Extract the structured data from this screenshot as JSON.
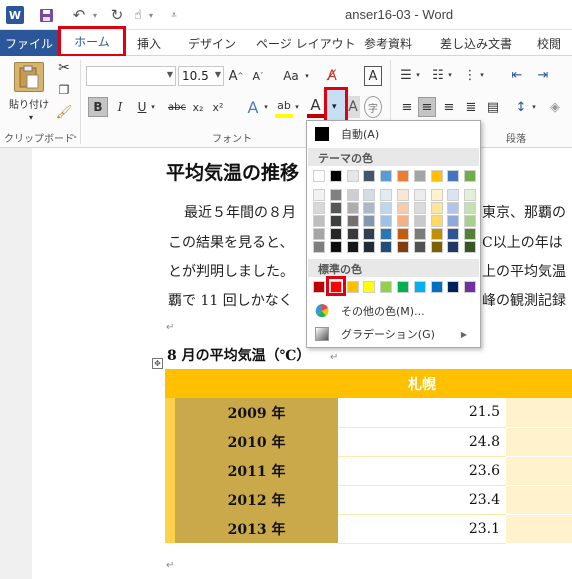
{
  "titlebar": {
    "app_icon": "W",
    "title": "anser16-03 - Word",
    "icons": [
      "word-logo-icon",
      "save-icon",
      "undo-icon",
      "redo-icon",
      "touch-mode-icon",
      "customize-qat-icon"
    ]
  },
  "tabs": {
    "file": "ファイル",
    "home": "ホーム",
    "items": [
      {
        "label": "挿入"
      },
      {
        "label": "デザイン"
      },
      {
        "label": "ページ レイアウト"
      },
      {
        "label": "参考資料"
      },
      {
        "label": "差し込み文書"
      },
      {
        "label": "校閲"
      }
    ]
  },
  "ribbon": {
    "clipboard": {
      "paste_label": "貼り付け",
      "group_label": "クリップボード"
    },
    "font": {
      "font_name": "",
      "font_size": "10.5",
      "grow": "A",
      "shrink": "A",
      "change_case": "Aa",
      "bold": "B",
      "italic": "I",
      "underline": "U",
      "strikethrough": "abc",
      "subscript": "x₂",
      "superscript": "x²",
      "text_effects": "A",
      "highlight": "ab",
      "font_color": "A",
      "shading": "A",
      "enclose": "字",
      "border_char": "A",
      "group_label": "フォント"
    },
    "paragraph": {
      "group_label": "段落"
    }
  },
  "document": {
    "heading": "平均気温の推移",
    "body_lines": [
      "最近５年間の８月",
      "この結果を見ると、",
      "とが判明しました。",
      "覇で 11 回しかなく"
    ],
    "body_right": [
      "東京、那覇の",
      "C以上の年は",
      "上の平均気温",
      "峰の観測記録"
    ],
    "table_title": "8 月の平均気温（℃）",
    "table": {
      "header": [
        "",
        "札幌"
      ],
      "rows": [
        {
          "year": "2009 年",
          "value": "21.5"
        },
        {
          "year": "2010 年",
          "value": "24.8"
        },
        {
          "year": "2011 年",
          "value": "23.6"
        },
        {
          "year": "2012 年",
          "value": "23.4"
        },
        {
          "year": "2013 年",
          "value": "23.1"
        }
      ]
    }
  },
  "color_menu": {
    "auto_label": "自動(A)",
    "theme_label": "テーマの色",
    "standard_label": "標準の色",
    "more_colors": "その他の色(M)...",
    "gradient": "グラデーション(G)",
    "theme_top": [
      "#ffffff",
      "#000000",
      "#e7e6e6",
      "#44546a",
      "#5b9bd5",
      "#ed7d31",
      "#a5a5a5",
      "#ffc000",
      "#4472c4",
      "#70ad47"
    ],
    "theme_shades": [
      [
        "#f2f2f2",
        "#808080",
        "#d0cece",
        "#d6dce4",
        "#deebf6",
        "#fbe5d5",
        "#ededed",
        "#fff2cc",
        "#dae3f3",
        "#e2efd9"
      ],
      [
        "#d8d8d8",
        "#595959",
        "#aeabab",
        "#adb9ca",
        "#bdd7ee",
        "#f7cbac",
        "#dbdbdb",
        "#fee599",
        "#b4c6e7",
        "#c5e0b3"
      ],
      [
        "#bfbfbf",
        "#3f3f3f",
        "#757070",
        "#8496b0",
        "#9cc3e5",
        "#f4b183",
        "#c9c9c9",
        "#ffd965",
        "#8eaadb",
        "#a8d08d"
      ],
      [
        "#a5a5a5",
        "#262626",
        "#3a3838",
        "#323f4f",
        "#2e75b5",
        "#c55a11",
        "#7b7b7b",
        "#bf9000",
        "#2f5496",
        "#538135"
      ],
      [
        "#7f7f7f",
        "#0c0c0c",
        "#171616",
        "#222a35",
        "#1e4e79",
        "#833c0b",
        "#525252",
        "#7f6000",
        "#1f3864",
        "#375623"
      ]
    ],
    "standard": [
      "#c00000",
      "#ff0000",
      "#ffc000",
      "#ffff00",
      "#92d050",
      "#00b050",
      "#00b0f0",
      "#0070c0",
      "#002060",
      "#7030a0"
    ],
    "accent": "#e0000f"
  }
}
